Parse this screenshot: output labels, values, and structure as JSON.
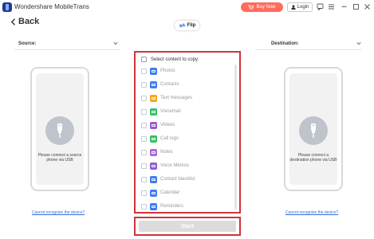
{
  "window": {
    "title": "Wondershare MobileTrans",
    "buy_now": "Buy Now",
    "login": "Login"
  },
  "nav": {
    "back_label": "Back"
  },
  "flip": {
    "label": "Flip"
  },
  "source": {
    "label": "Source:",
    "message": "Please connect a source phone via USB",
    "link": "Cannot recognize the device?"
  },
  "destination": {
    "label": "Destination:",
    "message": "Please connect a destination phone via USB",
    "link": "Cannot recognize the device?"
  },
  "content": {
    "header": "Select content to copy:",
    "items": [
      {
        "label": "Photos",
        "icon": "photos-icon",
        "color": "#3c7cf0"
      },
      {
        "label": "Contacts",
        "icon": "contacts-icon",
        "color": "#3c7cf0"
      },
      {
        "label": "Text messages",
        "icon": "text-messages-icon",
        "color": "#f5a623"
      },
      {
        "label": "Voicemail",
        "icon": "voicemail-icon",
        "color": "#34c267"
      },
      {
        "label": "Videos",
        "icon": "videos-icon",
        "color": "#9b59d6"
      },
      {
        "label": "Call logs",
        "icon": "call-logs-icon",
        "color": "#34c267"
      },
      {
        "label": "Notes",
        "icon": "notes-icon",
        "color": "#a86bd8"
      },
      {
        "label": "Voice Memos",
        "icon": "voice-memos-icon",
        "color": "#8e5bd6"
      },
      {
        "label": "Contact blacklist",
        "icon": "contact-blacklist-icon",
        "color": "#3c7cf0"
      },
      {
        "label": "Calendar",
        "icon": "calendar-icon",
        "color": "#3c7cf0"
      },
      {
        "label": "Reminders",
        "icon": "reminders-icon",
        "color": "#3c7cf0"
      }
    ]
  },
  "actions": {
    "start": "Start"
  },
  "colors": {
    "accent_red": "#d0343b",
    "buy_button": "#ff6c5c",
    "link": "#2f6fdb"
  }
}
